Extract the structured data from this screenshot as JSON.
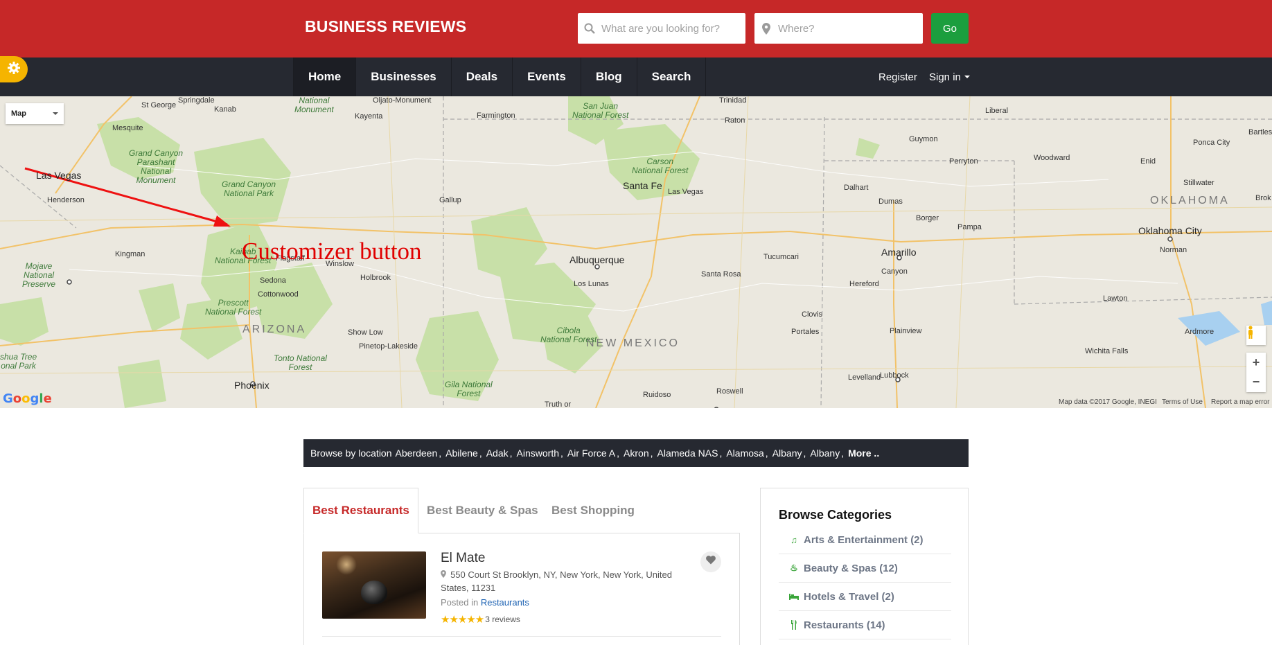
{
  "header": {
    "brand": "BUSINESS REVIEWS",
    "search_what_placeholder": "What are you looking for?",
    "search_where_placeholder": "Where?",
    "go_label": "Go"
  },
  "nav": {
    "items": [
      {
        "label": "Home",
        "active": true
      },
      {
        "label": "Businesses"
      },
      {
        "label": "Deals"
      },
      {
        "label": "Events"
      },
      {
        "label": "Blog"
      },
      {
        "label": "Search"
      }
    ],
    "register": "Register",
    "sign_in": "Sign in"
  },
  "map": {
    "type_select": "Map",
    "footer_data": "Map data ©2017 Google, INEGI",
    "terms": "Terms of Use",
    "report": "Report a map error",
    "logo": "Google",
    "labels": {
      "las_vegas": "Las Vegas",
      "henderson": "Henderson",
      "mesquite": "Mesquite",
      "st_george": "St George",
      "kanab": "Kanab",
      "springdale": "Springdale",
      "kayenta": "Kayenta",
      "oljato": "Oljato-Monument",
      "farmington": "Farmington",
      "gallup": "Gallup",
      "santa_fe": "Santa Fe",
      "las_vegas_nm": "Las Vegas",
      "albuquerque": "Albuquerque",
      "los_lunas": "Los Lunas",
      "santa_rosa": "Santa Rosa",
      "tucumcari": "Tucumcari",
      "clovis": "Clovis",
      "portales": "Portales",
      "roswell": "Roswell",
      "ruidoso": "Ruidoso",
      "truth_or": "Truth or",
      "amarillo": "Amarillo",
      "canyon": "Canyon",
      "hereford": "Hereford",
      "plainview": "Plainview",
      "lubbock": "Lubbock",
      "levelland": "Levelland",
      "dumas": "Dumas",
      "dalhart": "Dalhart",
      "borger": "Borger",
      "pampa": "Pampa",
      "perryton": "Perryton",
      "guymon": "Guymon",
      "liberal": "Liberal",
      "woodward": "Woodward",
      "enid": "Enid",
      "ponca_city": "Ponca City",
      "stillwater": "Stillwater",
      "oklahoma_city": "Oklahoma City",
      "norman": "Norman",
      "lawton": "Lawton",
      "ardmore": "Ardmore",
      "wichita_falls": "Wichita Falls",
      "kingman": "Kingman",
      "flagstaff": "Flagstaff",
      "winslow": "Winslow",
      "holbrook": "Holbrook",
      "sedona": "Sedona",
      "cottonwood": "Cottonwood",
      "show_low": "Show Low",
      "pinetop": "Pinetop-Lakeside",
      "phoenix": "Phoenix",
      "raton": "Raton",
      "trinidad": "Trinidad",
      "bartles": "Bartles",
      "brok": "Brok",
      "arizona": "ARIZONA",
      "new_mexico": "NEW MEXICO",
      "oklahoma": "OKLAHOMA",
      "gc_parashant": "Grand Canyon\nParashant\nNational\nMonument",
      "gc_np": "Grand Canyon\nNational Park",
      "kaibab": "Kaibab\nNational Forest",
      "prescott": "Prescott\nNational Forest",
      "tonto": "Tonto National\nForest",
      "mojave": "Mojave\nNational\nPreserve",
      "joshua": "shua Tree\nonal Park",
      "san_juan": "San Juan\nNational Forest",
      "carson": "Carson\nNational Forest",
      "cibola": "Cibola\nNational Forest",
      "gila": "Gila National\nForest",
      "monument": "National\nMonument"
    },
    "annotation": "Customizer button"
  },
  "browse_location": {
    "label": "Browse by location",
    "cities": [
      "Aberdeen",
      "Abilene",
      "Adak",
      "Ainsworth",
      "Air Force A",
      "Akron",
      "Alameda NAS",
      "Alamosa",
      "Albany",
      "Albany"
    ],
    "more": "More .."
  },
  "listing": {
    "tabs": [
      "Best Restaurants",
      "Best Beauty & Spas",
      "Best Shopping"
    ],
    "items": [
      {
        "title": "El Mate",
        "address": "550 Court St Brooklyn, NY, New York, New York, United States, 11231",
        "posted_prefix": "Posted in",
        "category": "Restaurants",
        "stars": "★★★★★",
        "reviews": "3 reviews"
      }
    ]
  },
  "categories": {
    "title": "Browse Categories",
    "items": [
      {
        "label": "Arts & Entertainment (2)",
        "icon": "music-note-icon"
      },
      {
        "label": "Beauty & Spas (12)",
        "icon": "spa-icon"
      },
      {
        "label": "Hotels & Travel (2)",
        "icon": "bed-icon"
      },
      {
        "label": "Restaurants (14)",
        "icon": "utensils-icon"
      }
    ]
  },
  "colors": {
    "header_red": "#c62828",
    "nav_dark": "#262931",
    "go_green": "#1b9e3e",
    "gear_yellow": "#f5b400",
    "annotation_red": "#e00000"
  }
}
